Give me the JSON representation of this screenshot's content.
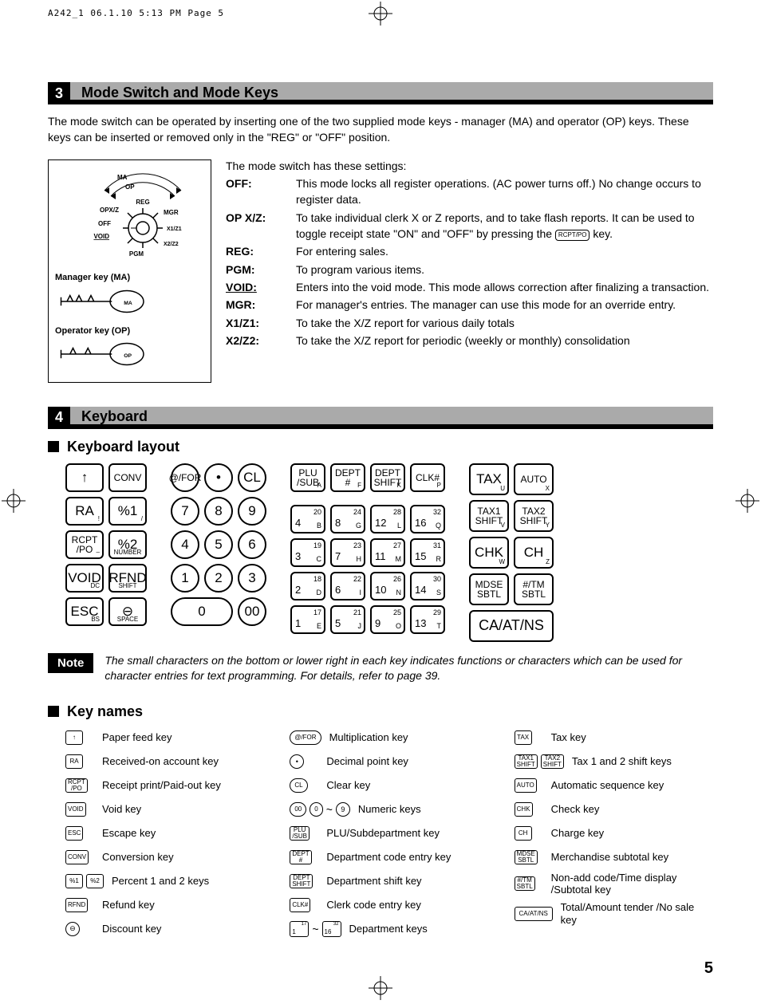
{
  "print_header": "A242_1  06.1.10 5:13 PM  Page 5",
  "section3": {
    "num": "3",
    "title": "Mode Switch and Mode Keys",
    "intro": "The mode switch can be operated by inserting one of the two supplied mode keys - manager (MA) and operator (OP) keys.  These keys can be inserted or removed only in the \"REG\" or \"OFF\" position.",
    "dial_labels": [
      "REG",
      "OPX/Z",
      "OFF",
      "VOID",
      "PGM",
      "MGR",
      "X1/Z1",
      "X2/Z2"
    ],
    "arc_labels": [
      "MA",
      "OP"
    ],
    "manager_key_label": "Manager key (MA)",
    "operator_key_label": "Operator key (OP)",
    "settings_intro": "The mode switch has these settings:",
    "settings": [
      {
        "term": "OFF:",
        "desc": "This mode locks all register operations. (AC power turns off.) No change occurs to register data."
      },
      {
        "term": "OP X/Z:",
        "desc_pre": "To take individual clerk X or Z reports, and to take flash reports. It can be used to toggle receipt state \"ON\" and \"OFF\" by pressing the ",
        "keycap": "RCPT/PO",
        "desc_post": " key."
      },
      {
        "term": "REG:",
        "desc": "For entering sales."
      },
      {
        "term": "PGM:",
        "desc": "To program various items."
      },
      {
        "term": "VOID:",
        "underline": true,
        "desc": "Enters into the void mode.  This mode allows correction after finalizing a transaction."
      },
      {
        "term": "MGR:",
        "desc": "For manager's entries.  The manager can use this mode for an override entry."
      },
      {
        "term": "X1/Z1:",
        "desc": "To take the X/Z report for various daily totals"
      },
      {
        "term": "X2/Z2:",
        "desc": "To take the X/Z report for periodic (weekly or monthly) consolidation"
      }
    ]
  },
  "section4": {
    "num": "4",
    "title": "Keyboard",
    "layout_heading": "Keyboard layout",
    "keynames_heading": "Key names",
    "left_block": [
      [
        {
          "main": "↑",
          "type": "rect"
        },
        {
          "main": "CONV",
          "type": "rect",
          "small": true
        }
      ],
      [
        {
          "main": "RA",
          "sub": "!",
          "type": "rect"
        },
        {
          "main": "%1",
          "sub": "/",
          "type": "rect"
        }
      ],
      [
        {
          "main": "RCPT /PO",
          "sub": "–",
          "type": "rect",
          "small": true
        },
        {
          "main": "%2",
          "subc": "NUMBER",
          "type": "rect"
        }
      ],
      [
        {
          "main": "VOID",
          "sub": "DC",
          "type": "rect"
        },
        {
          "main": "RFND",
          "subc": "SHIFT",
          "type": "rect"
        }
      ],
      [
        {
          "main": "ESC",
          "sub": "BS",
          "type": "rect"
        },
        {
          "main": "⊖",
          "subc": "SPACE",
          "type": "rect"
        }
      ]
    ],
    "num_block_top": [
      {
        "main": "@/FOR",
        "type": "round",
        "small": true
      },
      {
        "main": "•",
        "type": "round"
      },
      {
        "main": "CL",
        "type": "round"
      }
    ],
    "num_block": [
      [
        {
          "main": "7"
        },
        {
          "main": "8"
        },
        {
          "main": "9"
        }
      ],
      [
        {
          "main": "4"
        },
        {
          "main": "5"
        },
        {
          "main": "6"
        }
      ],
      [
        {
          "main": "1"
        },
        {
          "main": "2"
        },
        {
          "main": "3"
        }
      ]
    ],
    "num_block_bottom": [
      {
        "main": "0",
        "type": "wide"
      },
      {
        "main": "00",
        "type": "round"
      }
    ],
    "dept_headers": [
      {
        "l1": "PLU",
        "l2": "/SUB",
        "br": "A"
      },
      {
        "l1": "DEPT",
        "l2": "#",
        "br": "F"
      },
      {
        "l1": "DEPT",
        "l2": "SHIFT",
        "br": "K"
      },
      {
        "l1": "CLK#",
        "br": "P"
      }
    ],
    "dept_rows": [
      [
        {
          "top": "20",
          "bl": "4",
          "br": "B"
        },
        {
          "top": "24",
          "bl": "8",
          "br": "G"
        },
        {
          "top": "28",
          "bl": "12",
          "br": "L"
        },
        {
          "top": "32",
          "bl": "16",
          "br": "Q"
        }
      ],
      [
        {
          "top": "19",
          "bl": "3",
          "br": "C"
        },
        {
          "top": "23",
          "bl": "7",
          "br": "H"
        },
        {
          "top": "27",
          "bl": "11",
          "br": "M"
        },
        {
          "top": "31",
          "bl": "15",
          "br": "R"
        }
      ],
      [
        {
          "top": "18",
          "bl": "2",
          "br": "D"
        },
        {
          "top": "22",
          "bl": "6",
          "br": "I"
        },
        {
          "top": "26",
          "bl": "10",
          "br": "N"
        },
        {
          "top": "30",
          "bl": "14",
          "br": "S"
        }
      ],
      [
        {
          "top": "17",
          "bl": "1",
          "br": "E"
        },
        {
          "top": "21",
          "bl": "5",
          "br": "J"
        },
        {
          "top": "25",
          "bl": "9",
          "br": "O"
        },
        {
          "top": "29",
          "bl": "13",
          "br": "T"
        }
      ]
    ],
    "right_block": [
      [
        {
          "main": "TAX",
          "sub": "U"
        },
        {
          "main": "AUTO",
          "sub": "X",
          "small": true
        }
      ],
      [
        {
          "main": "TAX1 SHIFT",
          "sub": "V",
          "small": true
        },
        {
          "main": "TAX2 SHIFT",
          "sub": "Y",
          "small": true
        }
      ],
      [
        {
          "main": "CHK",
          "sub": "W"
        },
        {
          "main": "CH",
          "sub": "Z"
        }
      ],
      [
        {
          "main": "MDSE SBTL",
          "small": true
        },
        {
          "main": "#/TM SBTL",
          "small": true
        }
      ]
    ],
    "caat": "CA/AT/NS",
    "note_label": "Note",
    "note_text": "The small characters on the bottom or lower right in each key indicates functions or characters which can be used for character entries for text programming.  For details, refer to page 39.",
    "key_names": {
      "col1": [
        {
          "icons": [
            {
              "t": "rect",
              "txt": "↑"
            }
          ],
          "label": "Paper feed key"
        },
        {
          "icons": [
            {
              "t": "rect",
              "txt": "RA"
            }
          ],
          "label": "Received-on account key"
        },
        {
          "icons": [
            {
              "t": "rect",
              "txt": "RCPT /PO"
            }
          ],
          "label": "Receipt print/Paid-out key"
        },
        {
          "icons": [
            {
              "t": "rect",
              "txt": "VOID"
            }
          ],
          "label": "Void key"
        },
        {
          "icons": [
            {
              "t": "rect",
              "txt": "ESC"
            }
          ],
          "label": "Escape key"
        },
        {
          "icons": [
            {
              "t": "rect",
              "txt": "CONV"
            }
          ],
          "label": "Conversion key"
        },
        {
          "icons": [
            {
              "t": "rect",
              "txt": "%1"
            },
            {
              "t": "rect",
              "txt": "%2"
            }
          ],
          "label": "Percent 1 and 2 keys"
        },
        {
          "icons": [
            {
              "t": "rect",
              "txt": "RFND"
            }
          ],
          "label": "Refund key"
        },
        {
          "icons": [
            {
              "t": "round",
              "txt": "⊖"
            }
          ],
          "label": "Discount key"
        }
      ],
      "col2": [
        {
          "icons": [
            {
              "t": "pill",
              "txt": "@/FOR"
            }
          ],
          "label": "Multiplication key"
        },
        {
          "icons": [
            {
              "t": "round",
              "txt": "•"
            }
          ],
          "label": "Decimal point key"
        },
        {
          "icons": [
            {
              "t": "pill",
              "txt": "CL"
            }
          ],
          "label": "Clear key"
        },
        {
          "icons": [
            {
              "t": "pill",
              "txt": "00"
            },
            {
              "t": "pill",
              "txt": "0"
            },
            {
              "t": "tilde",
              "txt": "~"
            },
            {
              "t": "round",
              "txt": "9"
            }
          ],
          "label": "Numeric keys"
        },
        {
          "icons": [
            {
              "t": "rect",
              "txt": "PLU /SUB"
            }
          ],
          "label": "PLU/Subdepartment key"
        },
        {
          "icons": [
            {
              "t": "rect",
              "txt": "DEPT #"
            }
          ],
          "label": "Department code entry key"
        },
        {
          "icons": [
            {
              "t": "rect",
              "txt": "DEPT SHIFT"
            }
          ],
          "label": "Department shift key"
        },
        {
          "icons": [
            {
              "t": "rect",
              "txt": "CLK#"
            }
          ],
          "label": "Clerk code entry key"
        },
        {
          "icons": [
            {
              "t": "dept",
              "top": "17",
              "bl": "1"
            },
            {
              "t": "tilde",
              "txt": "~"
            },
            {
              "t": "dept",
              "top": "32",
              "bl": "16"
            }
          ],
          "label": "Department keys"
        }
      ],
      "col3": [
        {
          "icons": [
            {
              "t": "rect",
              "txt": "TAX"
            }
          ],
          "label": "Tax key"
        },
        {
          "icons": [
            {
              "t": "rect",
              "txt": "TAX1 SHIFT"
            },
            {
              "t": "rect",
              "txt": "TAX2 SHIFT"
            }
          ],
          "label": "Tax 1 and 2 shift keys"
        },
        {
          "icons": [
            {
              "t": "rect",
              "txt": "AUTO"
            }
          ],
          "label": "Automatic sequence key"
        },
        {
          "icons": [
            {
              "t": "rect",
              "txt": "CHK"
            }
          ],
          "label": "Check key"
        },
        {
          "icons": [
            {
              "t": "rect",
              "txt": "CH"
            }
          ],
          "label": "Charge key"
        },
        {
          "icons": [
            {
              "t": "rect",
              "txt": "MDSE SBTL"
            }
          ],
          "label": "Merchandise subtotal key"
        },
        {
          "icons": [
            {
              "t": "rect",
              "txt": "#/TM SBTL"
            }
          ],
          "label": "Non-add code/Time display /Subtotal key"
        },
        {
          "icons": [
            {
              "t": "rect",
              "txt": "CA/AT/NS",
              "w": 48
            }
          ],
          "label": "Total/Amount tender /No sale key"
        }
      ]
    }
  },
  "page_num": "5"
}
